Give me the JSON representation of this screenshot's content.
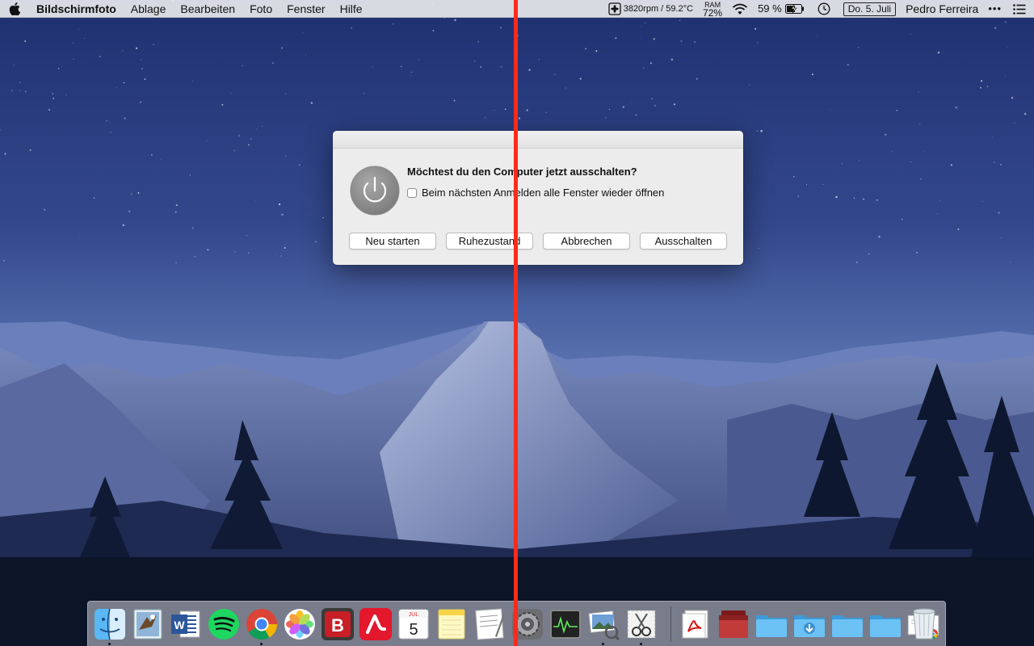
{
  "menubar": {
    "app_name": "Bildschirmfoto",
    "menus": [
      "Ablage",
      "Bearbeiten",
      "Foto",
      "Fenster",
      "Hilfe"
    ],
    "status": {
      "fan_temp": "3820rpm / 59.2°C",
      "ram_label": "RAM",
      "ram_value": "72%",
      "battery": "59 %",
      "date": "Do. 5. Juli",
      "user": "Pedro Ferreira",
      "more": "•••"
    }
  },
  "dialog": {
    "title": "Möchtest du den Computer jetzt ausschalten?",
    "checkbox_label": "Beim nächsten Anmelden alle Fenster wieder öffnen",
    "checkbox_checked": false,
    "buttons": {
      "restart": "Neu starten",
      "sleep": "Ruhezustand",
      "cancel": "Abbrechen",
      "shutdown": "Ausschalten"
    }
  },
  "dock": {
    "apps": [
      "finder-icon",
      "mail-icon",
      "word-icon",
      "spotify-icon",
      "chrome-icon",
      "photos-icon",
      "bitdefender-icon",
      "avira-icon",
      "calendar-icon",
      "notes-icon",
      "textedit-icon",
      "system-preferences-icon",
      "activity-monitor-icon",
      "preview-icon",
      "screenshot-icon",
      "pdf-icon",
      "books-icon",
      "folder-icon",
      "downloads-folder-icon",
      "folder-icon",
      "folder-icon",
      "chrome-document-icon",
      "trash-icon"
    ],
    "calendar_month": "JUL",
    "calendar_day": "5",
    "word_letter": "W",
    "bitdefender_letter": "B"
  },
  "colors": {
    "annotation_line": "#ff2a1a",
    "menubar_bg": "#e8e8ec",
    "dialog_bg": "#ececec"
  }
}
